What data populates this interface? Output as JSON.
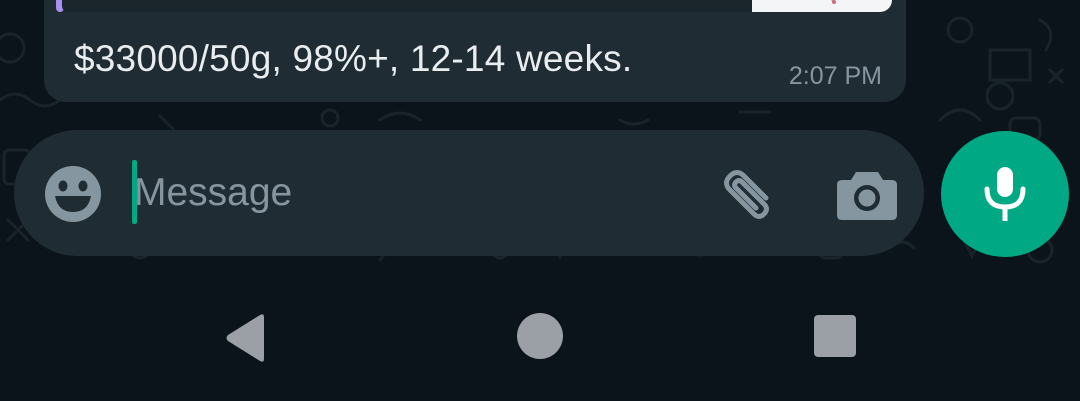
{
  "message": {
    "text": "$33000/50g, 98%+, 12-14 weeks.",
    "time": "2:07 PM",
    "quote_bar_color": "#a791f0"
  },
  "composer": {
    "placeholder": "Message",
    "caret_color": "#00a884",
    "icons": {
      "emoji": "emoji-icon",
      "attach": "paperclip-icon",
      "camera": "camera-icon"
    }
  },
  "mic_button": {
    "icon": "mic-icon",
    "color": "#00a884"
  },
  "navigation": {
    "back": "back-triangle-icon",
    "home": "home-circle-icon",
    "recents": "recents-square-icon"
  },
  "colors": {
    "background": "#0b141a",
    "bubble": "#202c33",
    "text_primary": "#e9edef",
    "text_secondary": "#8696a0",
    "accent": "#00a884"
  }
}
